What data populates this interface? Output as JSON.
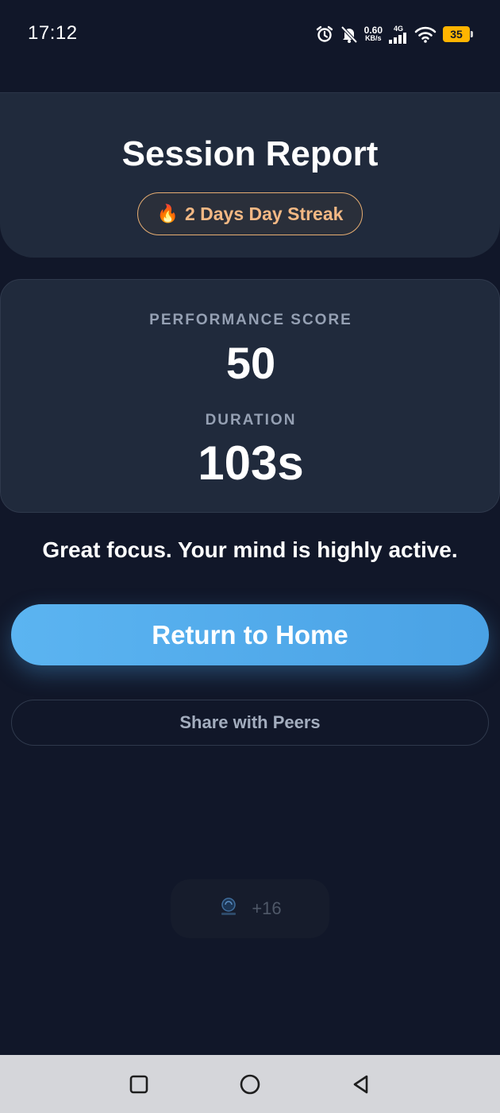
{
  "status_bar": {
    "time": "17:12",
    "net_speed_value": "0.60",
    "net_speed_unit": "KB/s",
    "network_type": "4G",
    "battery_level": "35",
    "icons": [
      "alarm-icon",
      "bell-muted-icon",
      "signal-icon",
      "wifi-icon",
      "battery-icon"
    ]
  },
  "header": {
    "title": "Session Report",
    "streak_label": "2 Days Day Streak",
    "streak_icon": "fire-icon"
  },
  "stats": {
    "score_label": "PERFORMANCE SCORE",
    "score_value": "50",
    "duration_label": "DURATION",
    "duration_value": "103s"
  },
  "feedback": "Great focus. Your mind is highly active.",
  "actions": {
    "primary_label": "Return to Home",
    "secondary_label": "Share with Peers"
  },
  "points": {
    "value": "+16",
    "icon": "brain-logo-icon"
  },
  "colors": {
    "background": "#111729",
    "card": "#202a3c",
    "accent": "#4aa2e5",
    "streak": "#f3b884",
    "battery": "#ffb400"
  },
  "nav_bar": {
    "icons": [
      "recents-icon",
      "home-icon",
      "back-icon"
    ]
  }
}
